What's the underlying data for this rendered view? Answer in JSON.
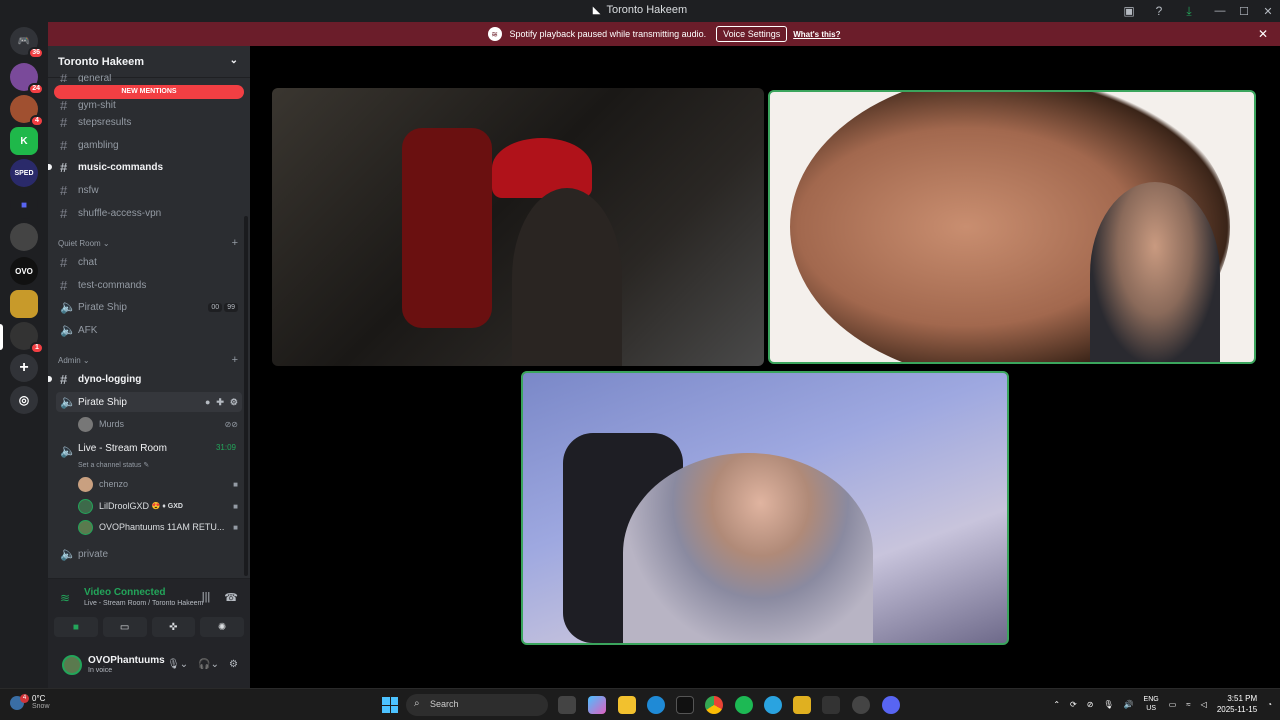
{
  "window": {
    "title": "Toronto Hakeem"
  },
  "banner": {
    "text": "Spotify playback paused while transmitting audio.",
    "button": "Voice Settings",
    "link": "What's this?"
  },
  "guild_badges": {
    "home": "36",
    "g2": "24",
    "g3": "4",
    "g_last": "1"
  },
  "server": {
    "name": "Toronto Hakeem",
    "new_mentions": "NEW MENTIONS"
  },
  "channels": {
    "general": "general",
    "gym": "gym-shit",
    "stepsresults": "stepsresults",
    "gambling": "gambling",
    "music": "music-commands",
    "nsfw": "nsfw",
    "shuffle": "shuffle-access-vpn"
  },
  "cat_quiet": "Quiet Room",
  "quiet": {
    "chat": "chat",
    "test": "test-commands",
    "pirate": "Pirate Ship",
    "pirate_count": "00",
    "pirate_limit": "99",
    "afk": "AFK"
  },
  "cat_admin": "Admin",
  "admin": {
    "dyno": "dyno-logging",
    "pirate": "Pirate Ship",
    "murds": "Murds",
    "live": "Live - Stream Room",
    "live_timer": "31:09",
    "live_status": "Set a channel status",
    "u1": "chenzo",
    "u2": "LilDroolGXD",
    "u2_tag": "GXD",
    "u3": "OVOPhantuums 11AM RETU...",
    "private": "private"
  },
  "voice": {
    "status": "Video Connected",
    "sub": "Live - Stream Room / Toronto Hakeem"
  },
  "user": {
    "name": "OVOPhantuums",
    "sub": "In voice"
  },
  "taskbar": {
    "temp": "0°C",
    "weather": "Snow",
    "weather_badge": "4",
    "search": "Search",
    "lang1": "ENG",
    "lang2": "US",
    "time": "3:51 PM",
    "date": "2025-11-15"
  },
  "colors": {
    "accent_green": "#23a55a",
    "banner": "#6b1d2a",
    "mention_red": "#f23f43",
    "sidebar": "#2b2d31"
  }
}
